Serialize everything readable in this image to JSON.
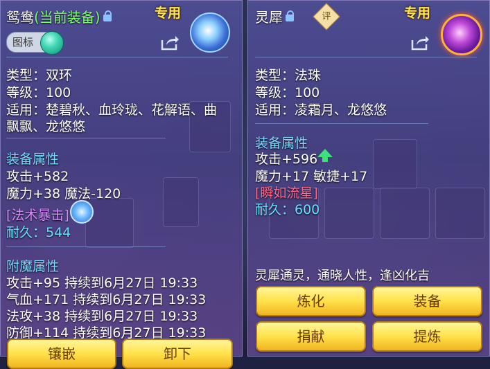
{
  "left": {
    "name": "鸳鸯",
    "status": "(当前装备)",
    "exclusive": "专用",
    "toggle_label": "图标",
    "type": "类型：双环",
    "level": "等级：100",
    "applicable1": "适用：楚碧秋、血玲珑、花解语、曲",
    "applicable2": "飘飘、龙悠悠",
    "attr_header": "装备属性",
    "attack": "攻击+582",
    "magic": "魔力+38 魔法-120",
    "skill": "[法术暴击]",
    "durability": "耐久：544",
    "enchant_header": "附魔属性",
    "enchant": [
      "攻击+95 持续到6月27日 19:33",
      "气血+171 持续到6月27日 19:33",
      "法攻+38 持续到6月27日 19:33",
      "防御+114 持续到6月27日 19:33"
    ],
    "btn_inlay": "镶嵌",
    "btn_unequip": "卸下"
  },
  "right": {
    "name": "灵犀",
    "grade": "评",
    "exclusive": "专用",
    "type": "类型：法珠",
    "level": "等级：100",
    "applicable": "适用：凌霜月、龙悠悠",
    "attr_header": "装备属性",
    "attack": "攻击+596",
    "stats": "魔力+17 敏捷+17",
    "skill": "[瞬如流星]",
    "durability": "耐久：600",
    "description": "灵犀通灵，通晓人性，逢凶化吉",
    "btn_refine": "炼化",
    "btn_equip": "装备",
    "btn_donate": "捐献",
    "btn_extract": "提炼"
  },
  "colors": {
    "header_blue": "#79d9ff",
    "durability_cyan": "#67e0ff",
    "exclusive_yellow": "#ffe44a",
    "current_green": "#7cff6a",
    "skill_purple": "#d88bff",
    "skill_red": "#ff6a8a",
    "button_gold": "#ffe14a"
  }
}
